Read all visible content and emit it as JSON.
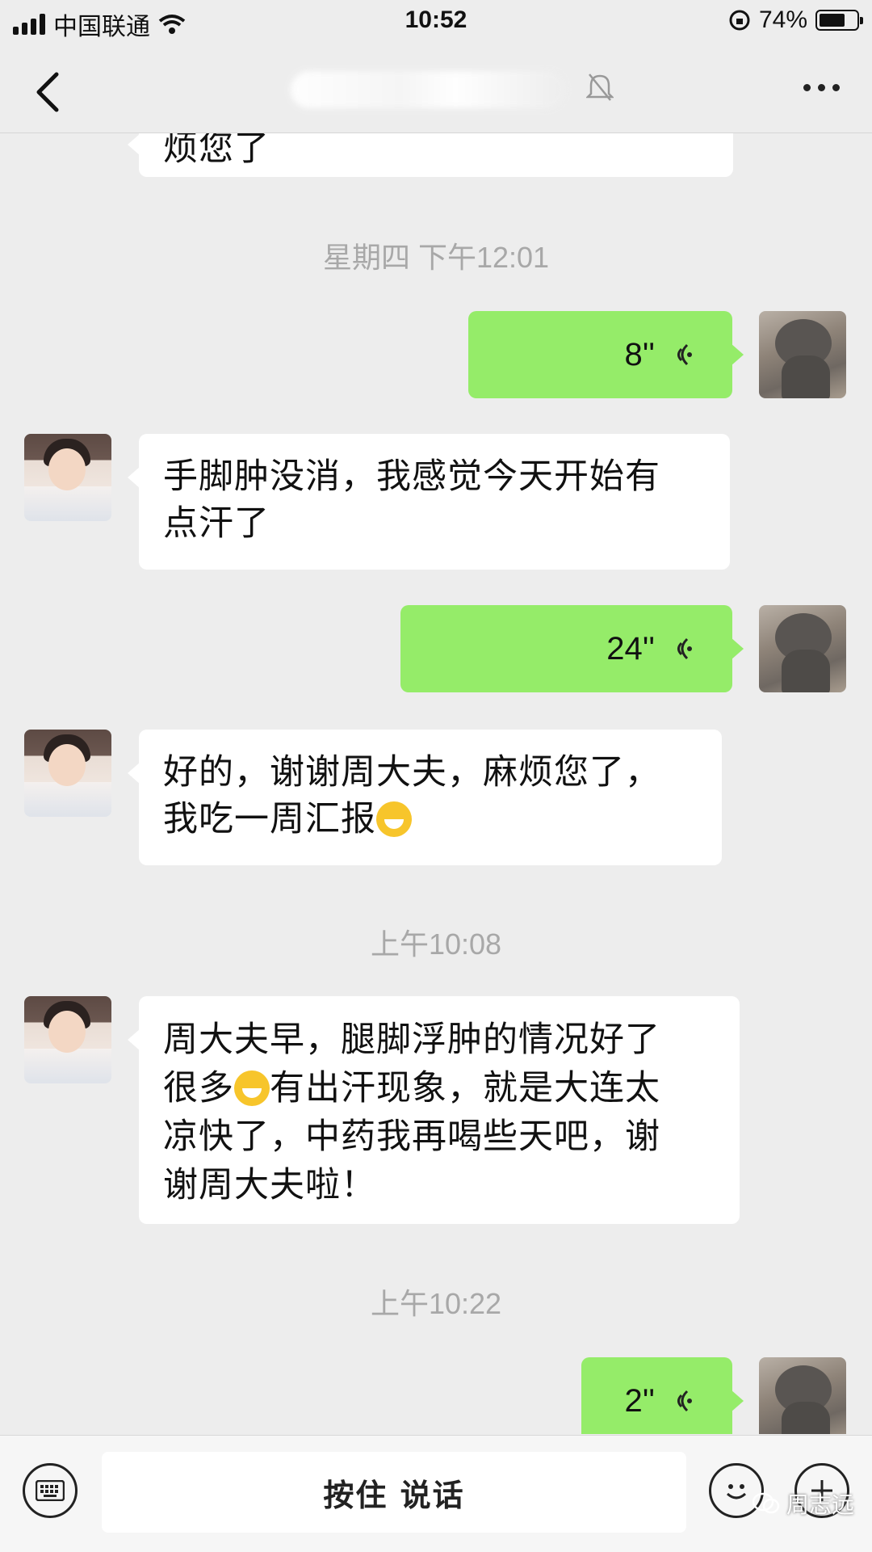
{
  "status_bar": {
    "carrier": "中国联通",
    "time": "10:52",
    "battery": "74%",
    "battery_level": 0.74
  },
  "nav": {
    "title": "",
    "more_label": "..."
  },
  "chat": {
    "top_partial_text": "烦您了",
    "timestamps": [
      "星期四 下午12:01",
      "上午10:08",
      "上午10:22"
    ],
    "messages": [
      {
        "side": "right",
        "type": "voice",
        "duration": "8''"
      },
      {
        "side": "left",
        "type": "text",
        "line1": "手脚肿没消，我感觉今天开始有",
        "line2": "点汗了"
      },
      {
        "side": "right",
        "type": "voice",
        "duration": "24''"
      },
      {
        "side": "left",
        "type": "text",
        "line1": "好的，谢谢周大夫，麻烦您了，",
        "line2": "我吃一周汇报"
      },
      {
        "side": "left",
        "type": "text",
        "line1": "周大夫早，腿脚浮肿的情况好了",
        "line2a": "很多",
        "line2b": "有出汗现象，就是大连太",
        "line3": "凉快了，中药我再喝些天吧，谢",
        "line4": "谢周大夫啦！"
      },
      {
        "side": "right",
        "type": "voice",
        "duration": "2''"
      }
    ]
  },
  "input_bar": {
    "hold_to_talk": "按住 说话",
    "watermark": "周志远"
  },
  "icons": {
    "back": "chevron-left-icon",
    "mute": "bell-mute-icon",
    "keyboard": "keyboard-icon",
    "emoji": "smiley-icon",
    "plus": "plus-icon",
    "voice": "voice-wave-icon"
  },
  "colors": {
    "background": "#ededed",
    "sent_bubble": "#95ec69",
    "received_bubble": "#ffffff"
  }
}
